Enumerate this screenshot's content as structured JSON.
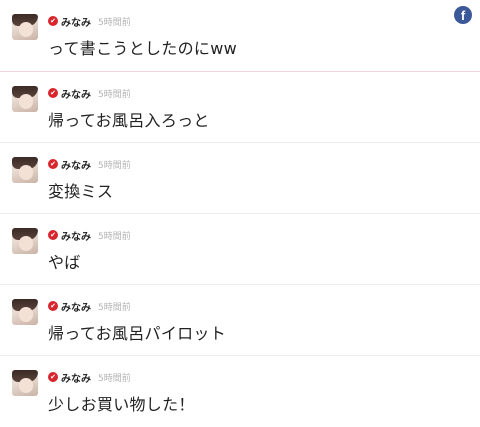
{
  "share": {
    "facebook_glyph": "f",
    "icon": "facebook-icon",
    "color": "#3b5998"
  },
  "accent": {
    "verified_badge": "#d7262d",
    "divider_highlight": "#f0d6dc"
  },
  "verified_glyph": "✔",
  "posts": [
    {
      "author": "みなみ",
      "time": "5時間前",
      "text": "って書こうとしたのにww"
    },
    {
      "author": "みなみ",
      "time": "5時間前",
      "text": "帰ってお風呂入ろっと"
    },
    {
      "author": "みなみ",
      "time": "5時間前",
      "text": "変換ミス"
    },
    {
      "author": "みなみ",
      "time": "5時間前",
      "text": "やば"
    },
    {
      "author": "みなみ",
      "time": "5時間前",
      "text": "帰ってお風呂パイロット"
    },
    {
      "author": "みなみ",
      "time": "5時間前",
      "text": "少しお買い物した！"
    }
  ]
}
